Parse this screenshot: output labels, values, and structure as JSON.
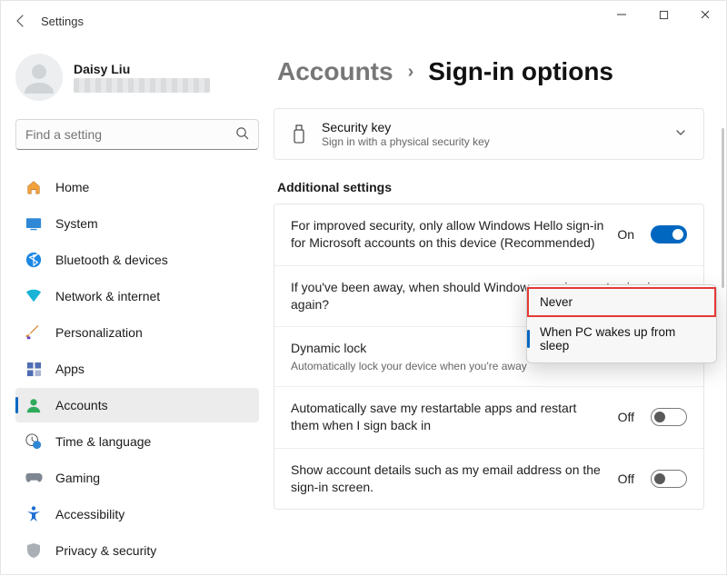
{
  "titlebar": {
    "title": "Settings"
  },
  "profile": {
    "name": "Daisy Liu"
  },
  "search": {
    "placeholder": "Find a setting"
  },
  "sidebar": {
    "items": [
      {
        "label": "Home",
        "icon": "home"
      },
      {
        "label": "System",
        "icon": "system"
      },
      {
        "label": "Bluetooth & devices",
        "icon": "bluetooth"
      },
      {
        "label": "Network & internet",
        "icon": "wifi"
      },
      {
        "label": "Personalization",
        "icon": "brush"
      },
      {
        "label": "Apps",
        "icon": "apps"
      },
      {
        "label": "Accounts",
        "icon": "person",
        "selected": true
      },
      {
        "label": "Time & language",
        "icon": "clock"
      },
      {
        "label": "Gaming",
        "icon": "gamepad"
      },
      {
        "label": "Accessibility",
        "icon": "accessibility"
      },
      {
        "label": "Privacy & security",
        "icon": "shield"
      }
    ]
  },
  "breadcrumb": {
    "section": "Accounts",
    "page": "Sign-in options"
  },
  "security_key_card": {
    "title": "Security key",
    "subtitle": "Sign in with a physical security key"
  },
  "additional_section": {
    "title": "Additional settings"
  },
  "rows": {
    "hello": {
      "text": "For improved security, only allow Windows Hello sign-in for Microsoft accounts on this device (Recommended)",
      "state": "On"
    },
    "away": {
      "text": "If you've been away, when should Windows require you to sign in again?"
    },
    "dynamic_lock": {
      "title": "Dynamic lock",
      "subtitle": "Automatically lock your device when you're away"
    },
    "restartable": {
      "text": "Automatically save my restartable apps and restart them when I sign back in",
      "state": "Off"
    },
    "show_email": {
      "text": "Show account details such as my email address on the sign-in screen.",
      "state": "Off"
    }
  },
  "dropdown": {
    "options": [
      {
        "label": "Never",
        "marked": true
      },
      {
        "label": "When PC wakes up from sleep",
        "highlighted": true
      }
    ]
  }
}
